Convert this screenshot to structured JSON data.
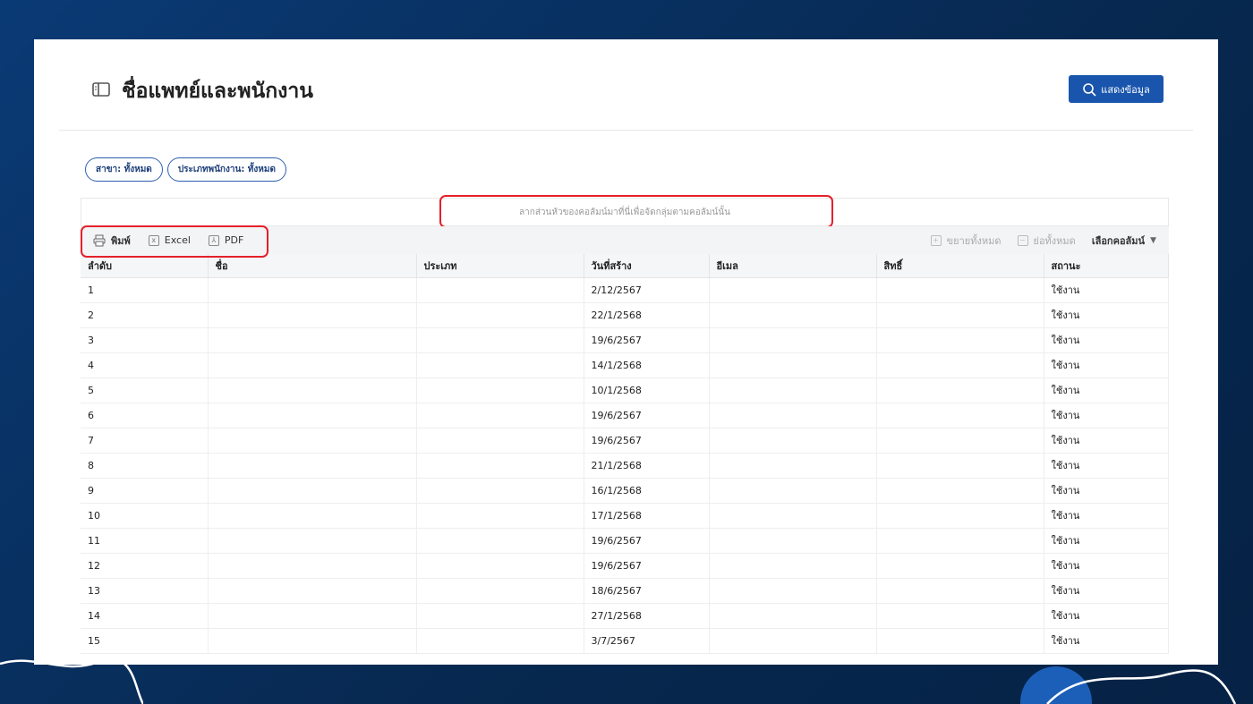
{
  "header": {
    "title": "ชื่อแพทย์และพนักงาน",
    "search_button": "แสดงข้อมูล"
  },
  "filters": [
    {
      "label": "สาขา: ทั้งหมด"
    },
    {
      "label": "ประเภทพนักงาน: ทั้งหมด"
    }
  ],
  "group_hint": "ลากส่วนหัวของคอลัมน์มาที่นี่เพื่อจัดกลุ่มตามคอลัมน์นั้น",
  "toolbar": {
    "print": "พิมพ์",
    "excel": "Excel",
    "pdf": "PDF",
    "expand_all": "ขยายทั้งหมด",
    "collapse_all": "ย่อทั้งหมด",
    "choose_columns": "เลือกคอลัมน์"
  },
  "columns": [
    "ลำดับ",
    "ชื่อ",
    "ประเภท",
    "วันที่สร้าง",
    "อีเมล",
    "สิทธิ์",
    "สถานะ"
  ],
  "rows": [
    {
      "no": "1",
      "date": "2/12/2567",
      "status": "ใช้งาน"
    },
    {
      "no": "2",
      "date": "22/1/2568",
      "status": "ใช้งาน"
    },
    {
      "no": "3",
      "date": "19/6/2567",
      "status": "ใช้งาน"
    },
    {
      "no": "4",
      "date": "14/1/2568",
      "status": "ใช้งาน"
    },
    {
      "no": "5",
      "date": "10/1/2568",
      "status": "ใช้งาน"
    },
    {
      "no": "6",
      "date": "19/6/2567",
      "status": "ใช้งาน"
    },
    {
      "no": "7",
      "date": "19/6/2567",
      "status": "ใช้งาน"
    },
    {
      "no": "8",
      "date": "21/1/2568",
      "status": "ใช้งาน"
    },
    {
      "no": "9",
      "date": "16/1/2568",
      "status": "ใช้งาน"
    },
    {
      "no": "10",
      "date": "17/1/2568",
      "status": "ใช้งาน"
    },
    {
      "no": "11",
      "date": "19/6/2567",
      "status": "ใช้งาน"
    },
    {
      "no": "12",
      "date": "19/6/2567",
      "status": "ใช้งาน"
    },
    {
      "no": "13",
      "date": "18/6/2567",
      "status": "ใช้งาน"
    },
    {
      "no": "14",
      "date": "27/1/2568",
      "status": "ใช้งาน"
    },
    {
      "no": "15",
      "date": "3/7/2567",
      "status": "ใช้งาน"
    }
  ]
}
